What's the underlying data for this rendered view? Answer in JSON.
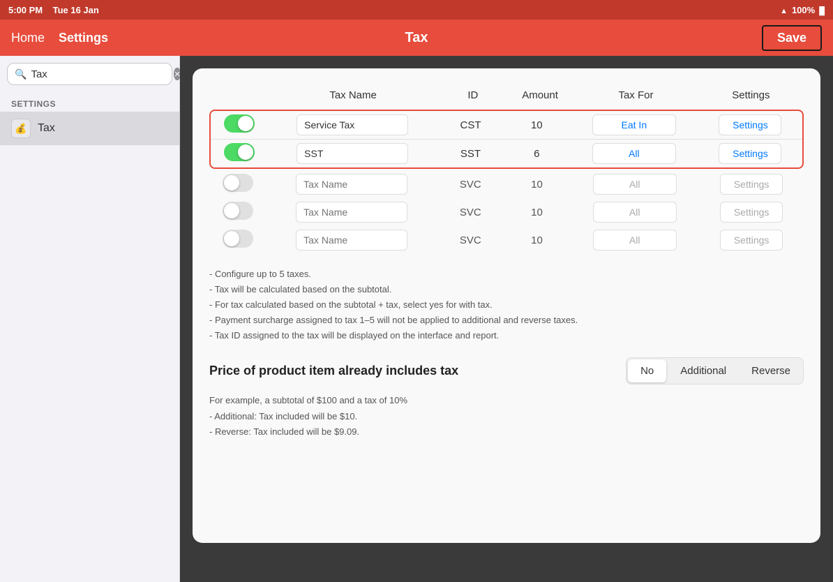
{
  "statusBar": {
    "time": "5:00 PM",
    "date": "Tue 16 Jan",
    "wifi": "WiFi",
    "battery": "100%"
  },
  "navBar": {
    "homeLabel": "Home",
    "settingsLabel": "Settings",
    "title": "Tax",
    "saveLabel": "Save"
  },
  "sidebar": {
    "searchPlaceholder": "Tax",
    "sectionLabel": "SETTINGS",
    "items": [
      {
        "label": "Tax",
        "icon": "💰"
      }
    ]
  },
  "table": {
    "headers": {
      "taxName": "Tax Name",
      "id": "ID",
      "amount": "Amount",
      "taxFor": "Tax For",
      "settings": "Settings"
    },
    "activeTaxes": [
      {
        "enabled": true,
        "name": "Service Tax",
        "id": "CST",
        "amount": "10",
        "taxFor": "Eat In",
        "settingsLabel": "Settings"
      },
      {
        "enabled": true,
        "name": "SST",
        "id": "SST",
        "amount": "6",
        "taxFor": "All",
        "settingsLabel": "Settings"
      }
    ],
    "emptyTaxes": [
      {
        "enabled": false,
        "name": "Tax Name",
        "id": "SVC",
        "amount": "10",
        "taxFor": "All",
        "settingsLabel": "Settings"
      },
      {
        "enabled": false,
        "name": "Tax Name",
        "id": "SVC",
        "amount": "10",
        "taxFor": "All",
        "settingsLabel": "Settings"
      },
      {
        "enabled": false,
        "name": "Tax Name",
        "id": "SVC",
        "amount": "10",
        "taxFor": "All",
        "settingsLabel": "Settings"
      }
    ]
  },
  "notes": [
    "- Configure up to 5 taxes.",
    "- Tax will be calculated based on the subtotal.",
    "- For tax calculated based on the subtotal + tax, select yes for with tax.",
    "- Payment surcharge assigned to tax 1–5 will not be applied to additional and reverse taxes.",
    "- Tax ID assigned to the tax will be displayed on the interface and report."
  ],
  "priceSection": {
    "label": "Price of product item already includes tax",
    "options": [
      "No",
      "Additional",
      "Reverse"
    ],
    "activeOption": "No"
  },
  "priceExample": [
    "For example, a subtotal of $100 and a tax of 10%",
    "- Additional: Tax included will be $10.",
    "- Reverse: Tax included will be $9.09."
  ]
}
